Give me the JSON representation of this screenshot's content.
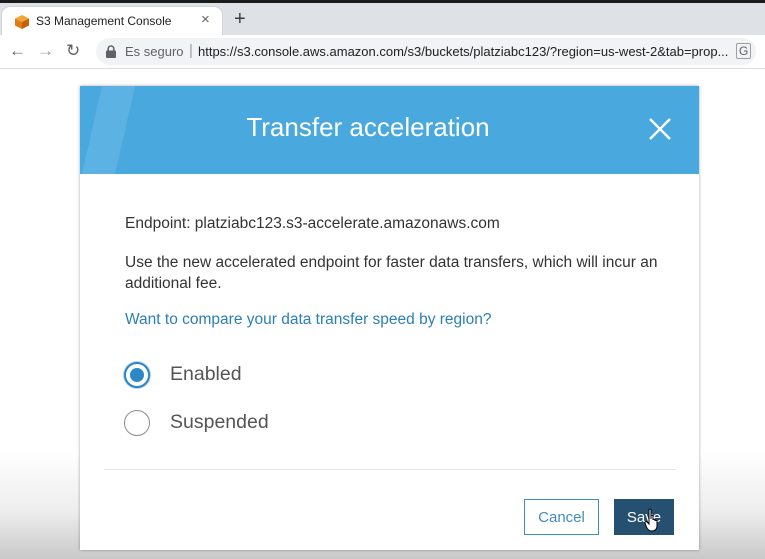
{
  "browser": {
    "tab_title": "S3 Management Console",
    "tab_close": "×",
    "new_tab": "+",
    "back": "←",
    "forward": "→",
    "reload": "↻",
    "security_label": "Es seguro",
    "separator": "|",
    "url": "https://s3.console.aws.amazon.com/s3/buckets/platziabc123/?region=us-west-2&tab=prop...",
    "translate_icon_text": "G"
  },
  "modal": {
    "title": "Transfer acceleration",
    "endpoint_line": "Endpoint: platziabc123.s3-accelerate.amazonaws.com",
    "description": "Use the new accelerated endpoint for faster data transfers, which will incur an additional fee.",
    "compare_link": "Want to compare your data transfer speed by region?",
    "options": [
      {
        "label": "Enabled",
        "checked": true
      },
      {
        "label": "Suspended",
        "checked": false
      }
    ],
    "cancel_label": "Cancel",
    "save_label": "Save"
  },
  "colors": {
    "header_blue": "#49a9df",
    "link_blue": "#2a7fb6",
    "radio_blue": "#2b87c8",
    "save_button": "#26506f",
    "cancel_border": "#3f8dbb"
  },
  "icons": {
    "favicon": "aws-s3-cube-icon",
    "lock": "lock-icon",
    "close": "close-icon",
    "cursor": "hand-pointer-icon"
  }
}
